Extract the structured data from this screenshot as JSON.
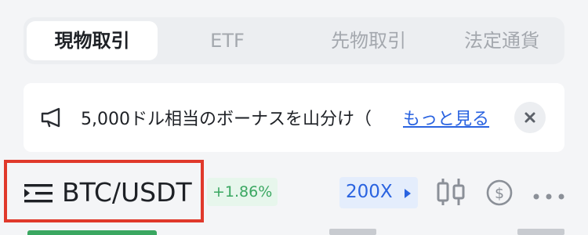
{
  "tabs": [
    {
      "label": "現物取引",
      "active": true
    },
    {
      "label": "ETF",
      "active": false
    },
    {
      "label": "先物取引",
      "active": false
    },
    {
      "label": "法定通貨",
      "active": false
    }
  ],
  "banner": {
    "icon": "megaphone-icon",
    "text": "5,000ドル相当のボーナスを山分け（",
    "link": "もっと見る",
    "close_icon": "close-icon"
  },
  "pair": {
    "icon": "list-menu-icon",
    "name": "BTC/USDT",
    "change": "+1.86%",
    "change_color": "#3aa761"
  },
  "toolbar": {
    "leverage": "200X",
    "icons": [
      "candlestick-chart-icon",
      "dollar-icon",
      "more-icon"
    ]
  },
  "colors": {
    "accent": "#2a63e0",
    "positive": "#3aa761",
    "highlight_border": "#e0392b"
  }
}
